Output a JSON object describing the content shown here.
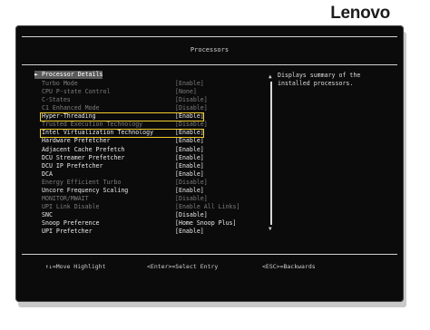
{
  "brand": "Lenovo",
  "title": "Processors",
  "menu": {
    "selected": "Processor Details",
    "items": [
      {
        "label": "Turbo Mode",
        "value": "[Enable]",
        "state": "disabled"
      },
      {
        "label": "CPU P-state Control",
        "value": "[None]",
        "state": "disabled"
      },
      {
        "label": "C-States",
        "value": "[Disable]",
        "state": "disabled"
      },
      {
        "label": "C1 Enhanced Mode",
        "value": "[Disable]",
        "state": "disabled"
      },
      {
        "label": "Hyper-Threading",
        "value": "[Enable]",
        "state": "highlight"
      },
      {
        "label": "Trusted Execution Technology",
        "value": "[Disable]",
        "state": "disabled"
      },
      {
        "label": "Intel Virtualization Technology",
        "value": "[Enable]",
        "state": "highlight"
      },
      {
        "label": "Hardware Prefetcher",
        "value": "[Enable]",
        "state": "enabled"
      },
      {
        "label": "Adjacent Cache Prefetch",
        "value": "[Enable]",
        "state": "enabled"
      },
      {
        "label": "DCU Streamer Prefetcher",
        "value": "[Enable]",
        "state": "enabled"
      },
      {
        "label": "DCU IP Prefetcher",
        "value": "[Enable]",
        "state": "enabled"
      },
      {
        "label": "DCA",
        "value": "[Enable]",
        "state": "enabled"
      },
      {
        "label": "Energy Efficient Turbo",
        "value": "[Disable]",
        "state": "disabled"
      },
      {
        "label": "Uncore Frequency Scaling",
        "value": "[Enable]",
        "state": "enabled"
      },
      {
        "label": "MONITOR/MWAIT",
        "value": "[Disable]",
        "state": "disabled"
      },
      {
        "label": "UPI Link Disable",
        "value": "[Enable All Links]",
        "state": "disabled"
      },
      {
        "label": "SNC",
        "value": "[Disable]",
        "state": "enabled"
      },
      {
        "label": "Snoop Preference",
        "value": "[Home Snoop Plus]",
        "state": "enabled"
      },
      {
        "label": "UPI Prefetcher",
        "value": "[Enable]",
        "state": "enabled"
      }
    ]
  },
  "help": {
    "line1": "Displays summary of the",
    "line2": "installed processors."
  },
  "footer": {
    "move": "↑↓=Move Highlight",
    "select": "<Enter>=Select Entry",
    "back": "<ESC>=Backwards"
  },
  "colors": {
    "highlight_border": "#f0cc2e",
    "screen_bg": "#0b0b0b"
  },
  "icons": {
    "selected_marker": "triangle-right-icon",
    "scroll_up": "scroll-up-arrow-icon",
    "scroll_down": "scroll-down-arrow-icon"
  }
}
